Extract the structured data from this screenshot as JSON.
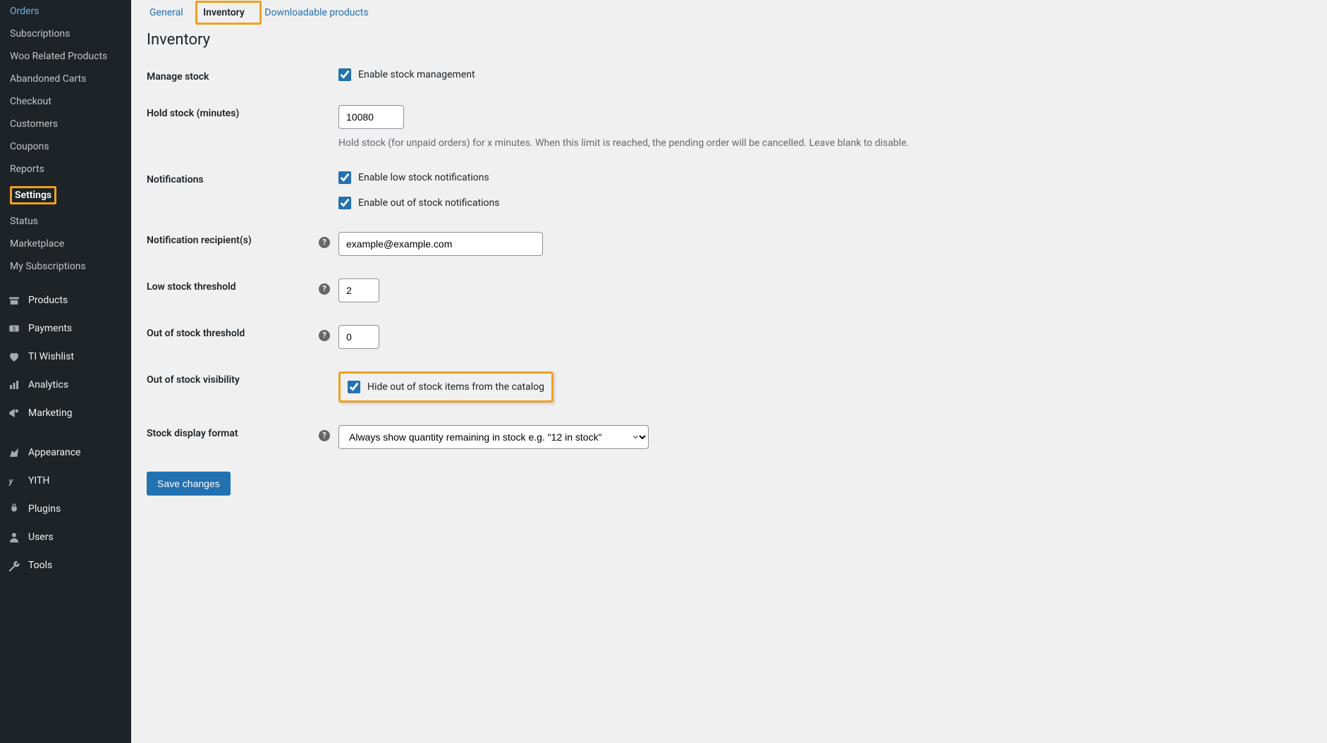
{
  "sidebar": {
    "sub_items": [
      "Orders",
      "Subscriptions",
      "Woo Related Products",
      "Abandoned Carts",
      "Checkout",
      "Customers",
      "Coupons",
      "Reports",
      "Settings",
      "Status",
      "Marketplace",
      "My Subscriptions"
    ],
    "active_sub": "Settings",
    "top_items": [
      {
        "label": "Products",
        "icon": "products-icon"
      },
      {
        "label": "Payments",
        "icon": "payments-icon"
      },
      {
        "label": "TI Wishlist",
        "icon": "wishlist-icon"
      },
      {
        "label": "Analytics",
        "icon": "analytics-icon"
      },
      {
        "label": "Marketing",
        "icon": "marketing-icon"
      },
      {
        "label": "Appearance",
        "icon": "appearance-icon"
      },
      {
        "label": "YITH",
        "icon": "yith-icon"
      },
      {
        "label": "Plugins",
        "icon": "plugins-icon"
      },
      {
        "label": "Users",
        "icon": "users-icon"
      },
      {
        "label": "Tools",
        "icon": "tools-icon"
      }
    ]
  },
  "tabs": {
    "general": "General",
    "inventory": "Inventory",
    "downloadable": "Downloadable products"
  },
  "section_title": "Inventory",
  "fields": {
    "manage_stock": {
      "label": "Manage stock",
      "checkbox_label": "Enable stock management",
      "checked": true
    },
    "hold_stock": {
      "label": "Hold stock (minutes)",
      "value": "10080",
      "description": "Hold stock (for unpaid orders) for x minutes. When this limit is reached, the pending order will be cancelled. Leave blank to disable."
    },
    "notifications": {
      "label": "Notifications",
      "low_label": "Enable low stock notifications",
      "low_checked": true,
      "out_label": "Enable out of stock notifications",
      "out_checked": true
    },
    "recipients": {
      "label": "Notification recipient(s)",
      "value": "example@example.com"
    },
    "low_threshold": {
      "label": "Low stock threshold",
      "value": "2"
    },
    "out_threshold": {
      "label": "Out of stock threshold",
      "value": "0"
    },
    "visibility": {
      "label": "Out of stock visibility",
      "checkbox_label": "Hide out of stock items from the catalog",
      "checked": true
    },
    "display_format": {
      "label": "Stock display format",
      "selected": "Always show quantity remaining in stock e.g. \"12 in stock\""
    }
  },
  "save_button": "Save changes"
}
